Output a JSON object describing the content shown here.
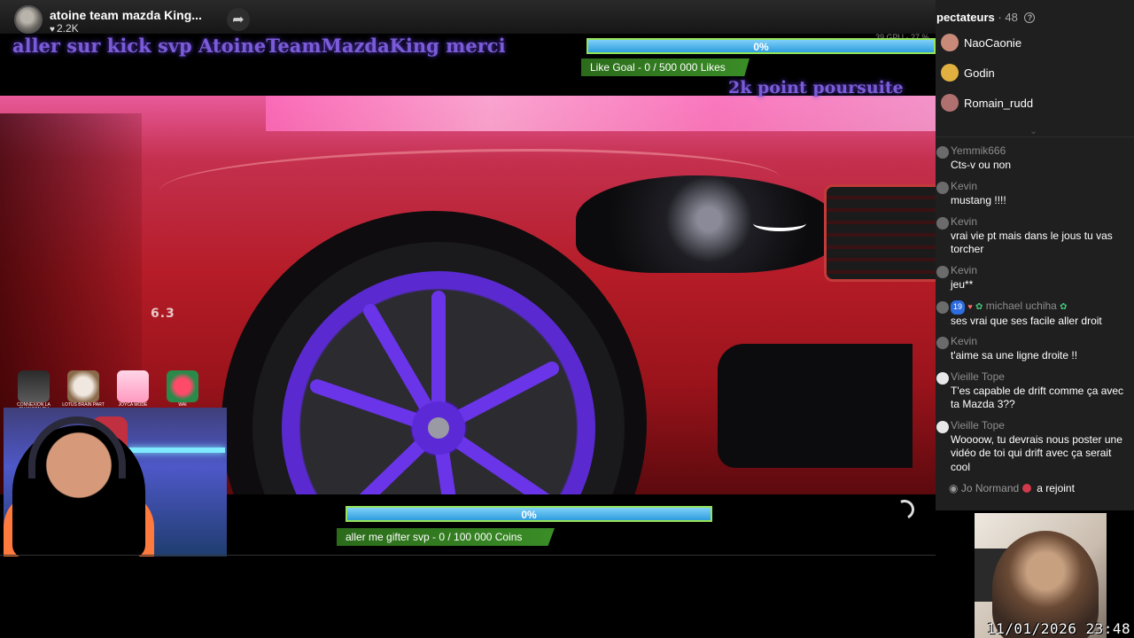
{
  "header": {
    "title": "atoine team mazda King...",
    "likes": "2.2K",
    "share_icon": "share-arrow-icon"
  },
  "overlay": {
    "kick_text": "aller sur kick svp AtoineTeamMazdaKing merci",
    "points_text": "2k point poursuite",
    "gpu_readout": "39 GPU · 27 %",
    "like_goal": {
      "percent": "0%",
      "progress": 0,
      "label": "Like Goal - 0 / 500 000 Likes"
    },
    "gift_goal": {
      "percent": "0%",
      "progress": 0,
      "label": "aller me gifter svp - 0 / 100 000 Coins"
    },
    "car_badge": "6.3",
    "alerts": [
      {
        "caption": "CONNEXION LA CHANSON DU GÉNÉRIQUE TÉLÉ QUÉBEC.MP3"
      },
      {
        "caption": "LOTUS BRAIN PART"
      },
      {
        "caption": "JOYCA MODE"
      },
      {
        "caption": "WAI"
      }
    ]
  },
  "chat": {
    "viewers_label": "pectateurs",
    "viewers_count": "48",
    "top_viewers": [
      {
        "name": "NaoCaonie",
        "color": "#c98a7a"
      },
      {
        "name": "Godin",
        "color": "#e0b040"
      },
      {
        "name": "Romain_rudd",
        "color": "#b07070"
      }
    ],
    "messages": [
      {
        "user": "Yemmik666",
        "text": "Cts-v ou non"
      },
      {
        "user": "Kevin",
        "text": "mustang !!!!"
      },
      {
        "user": "Kevin",
        "text": "vrai vie pt mais dans le jous tu vas torcher"
      },
      {
        "user": "Kevin",
        "text": "jeu**"
      },
      {
        "user": "michael uchiha",
        "level": "19",
        "text": "ses vrai que ses facile aller droit"
      },
      {
        "user": "Kevin",
        "text": "t'aime sa une ligne droite !!"
      },
      {
        "user": "Vieille Tope",
        "text": "T'es capable de drift comme ça avec ta Mazda 3??"
      },
      {
        "user": "Vieille Tope",
        "text": "Woooow, tu devrais nous poster une vidéo de toi qui drift avec ça serait cool"
      }
    ],
    "join": {
      "user": "Jo Normand",
      "text": "a rejoint"
    }
  },
  "small_cam": {
    "timestamp": "11/01/2026 23:48"
  }
}
